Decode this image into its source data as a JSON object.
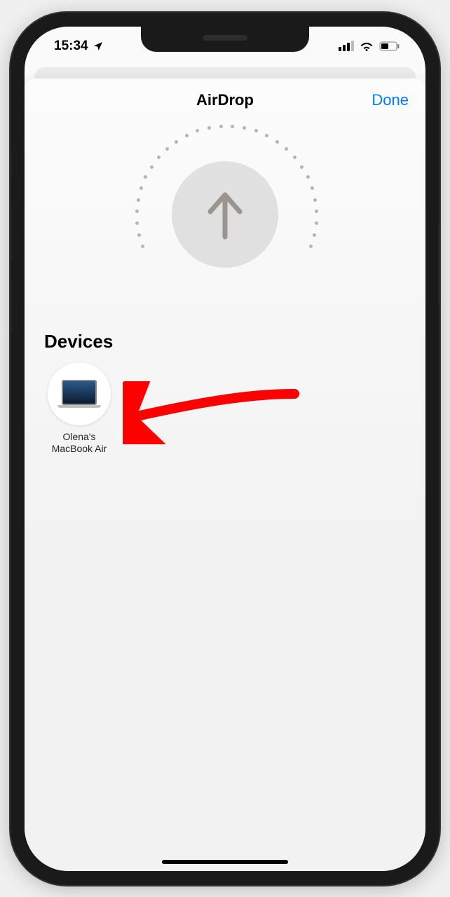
{
  "status": {
    "time": "15:34"
  },
  "sheet": {
    "title": "AirDrop",
    "done_label": "Done",
    "section_heading": "Devices",
    "devices": [
      {
        "label": "Olena's MacBook Air"
      }
    ]
  }
}
